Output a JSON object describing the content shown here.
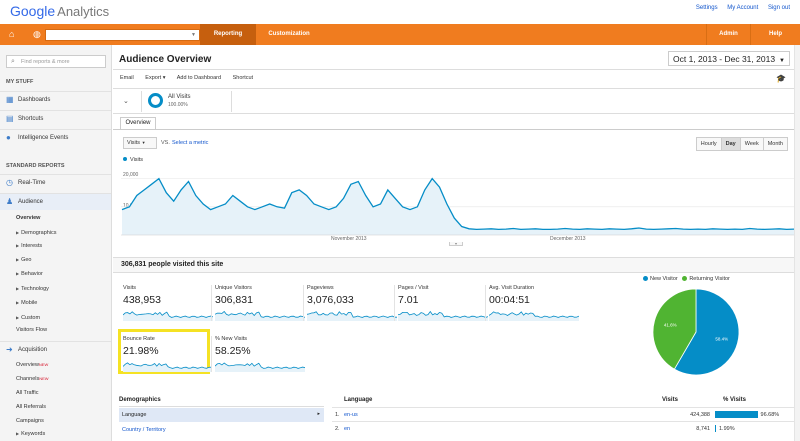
{
  "app": {
    "logo_google": "Google",
    "logo_product": "Analytics",
    "top_links": [
      "Settings",
      "My Account",
      "Sign out"
    ]
  },
  "nav": {
    "tabs": [
      {
        "label": "Reporting",
        "active": true
      },
      {
        "label": "Customization",
        "active": false
      }
    ],
    "right": [
      "Admin",
      "Help"
    ],
    "account_value": ""
  },
  "sidebar": {
    "search_placeholder": "Find reports & more",
    "my_stuff_label": "MY STUFF",
    "my_stuff": [
      "Dashboards",
      "Shortcuts",
      "Intelligence Events"
    ],
    "standard_label": "STANDARD REPORTS",
    "realtime": "Real-Time",
    "audience": "Audience",
    "audience_sub": [
      "Overview",
      "Demographics",
      "Interests",
      "Geo",
      "Behavior",
      "Technology",
      "Mobile",
      "Custom",
      "Visitors Flow"
    ],
    "acquisition": "Acquisition",
    "acquisition_sub": [
      "Overview",
      "Channels",
      "All Traffic",
      "All Referrals",
      "Campaigns",
      "Keywords"
    ],
    "new_tag": "NEW"
  },
  "page": {
    "title": "Audience Overview",
    "date_range": "Oct 1, 2013 - Dec 31, 2013",
    "toolbar": [
      "Email",
      "Export ▾",
      "Add to Dashboard",
      "Shortcut"
    ],
    "segment_name": "All Visits",
    "segment_pct": "100.00%",
    "tab": "Overview",
    "metric_select": "Visits",
    "vs": "VS.",
    "select_metric": "Select a metric",
    "granularity": [
      "Hourly",
      "Day",
      "Week",
      "Month"
    ],
    "granularity_selected": "Day",
    "visitors_headline": "306,831 people visited this site"
  },
  "chart_data": {
    "type": "area",
    "series": [
      {
        "name": "Visits",
        "values": [
          9000,
          10000,
          14000,
          16000,
          18000,
          20000,
          15000,
          12000,
          16000,
          19000,
          14000,
          11000,
          9000,
          10000,
          11000,
          14000,
          12000,
          10000,
          9000,
          10000,
          11000,
          10000,
          9500,
          15000,
          16000,
          14000,
          11000,
          10000,
          9000,
          10000,
          13000,
          18000,
          19000,
          14000,
          10000,
          11000,
          16000,
          13000,
          10000,
          9000,
          10000,
          16000,
          20000,
          17000,
          11000,
          6000,
          3000,
          2200,
          2000,
          2100,
          2200,
          2000,
          2100,
          2300,
          2000,
          2100,
          2200,
          2000,
          2000,
          2100,
          2300,
          2100,
          2000,
          2200,
          2100,
          2000,
          2200,
          2100,
          2000,
          2200,
          2500,
          2100,
          2000,
          2100,
          2200,
          2300,
          2100,
          2000,
          2100,
          2000,
          2200,
          2100,
          2000,
          2100,
          2000,
          2300,
          2100,
          2000,
          2100,
          2200,
          2000,
          2100
        ]
      }
    ],
    "y_ticks": [
      "20,000",
      "10,000"
    ],
    "x_ticks": [
      "November 2013",
      "December 2013"
    ],
    "ylim": [
      0,
      22000
    ]
  },
  "metrics": [
    {
      "label": "Visits",
      "value": "438,953"
    },
    {
      "label": "Unique Visitors",
      "value": "306,831"
    },
    {
      "label": "Pageviews",
      "value": "3,076,033"
    },
    {
      "label": "Pages / Visit",
      "value": "7.01"
    },
    {
      "label": "Avg. Visit Duration",
      "value": "00:04:51"
    },
    {
      "label": "Bounce Rate",
      "value": "21.98%"
    },
    {
      "label": "% New Visits",
      "value": "58.25%"
    }
  ],
  "pie": {
    "legend": [
      "New Visitor",
      "Returning Visitor"
    ],
    "colors": [
      "#058dc7",
      "#50b432"
    ],
    "values": [
      58.4,
      41.6
    ],
    "labels": [
      "58.4%",
      "41.6%"
    ]
  },
  "demographics": {
    "header": "Demographics",
    "items": [
      "Language",
      "Country / Territory"
    ],
    "selected": "Language"
  },
  "lang_table": {
    "headers": [
      "Language",
      "Visits",
      "% Visits"
    ],
    "rows": [
      {
        "n": "1.",
        "lang": "en-us",
        "visits": "424,388",
        "pct": "96.68%",
        "frac": 0.9668
      },
      {
        "n": "2.",
        "lang": "en",
        "visits": "8,741",
        "pct": "1.99%",
        "frac": 0.0199
      }
    ]
  },
  "colors": {
    "accent": "#f07c1f",
    "series": "#058dc7",
    "highlight": "#f5e224"
  }
}
